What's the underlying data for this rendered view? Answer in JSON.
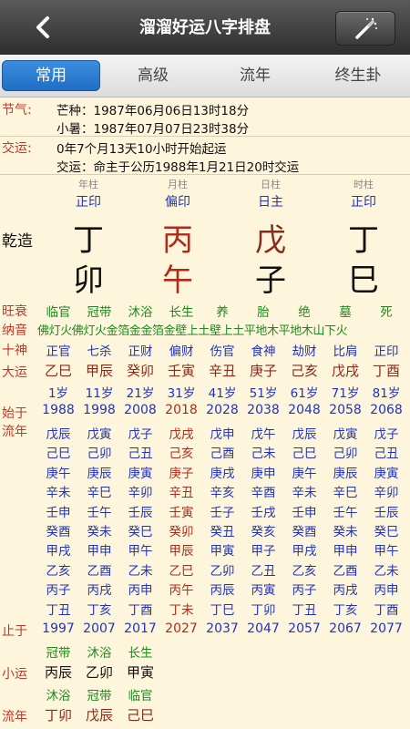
{
  "header": {
    "title": "溜溜好运八字排盘",
    "back_icon": "chevron-left-icon",
    "action_icon": "magic-wand-icon"
  },
  "tabs": [
    {
      "label": "常用",
      "active": true
    },
    {
      "label": "高级",
      "active": false
    },
    {
      "label": "流年",
      "active": false
    },
    {
      "label": "终生卦",
      "active": false
    }
  ],
  "info": {
    "jieqi_label": "节气:",
    "jieqi_1": "芒种：1987年06月06日13时18分",
    "jieqi_2": "小暑：1987年07月07日23时38分",
    "jiaoyun_label": "交运:",
    "jiaoyun_1": "0年7个月13天10小时开始起运",
    "jiaoyun_2": "交运：命主于公历1988年1月21日20时交运"
  },
  "pillars": {
    "headers": [
      "年柱",
      "月柱",
      "日柱",
      "时柱"
    ],
    "shishen": [
      "正印",
      "偏印",
      "日主",
      "正印"
    ],
    "qianzao_label": "乾造",
    "stems": [
      "丁",
      "丙",
      "戊",
      "丁"
    ],
    "branches": [
      "卯",
      "午",
      "子",
      "巳"
    ]
  },
  "wangshuai": {
    "label": "旺衰",
    "values": [
      "临官",
      "冠带",
      "沐浴",
      "长生",
      "养",
      "胎",
      "绝",
      "墓",
      "死"
    ]
  },
  "nayin": {
    "label": "纳音",
    "text": "佛灯火佛灯火金箔金金箔金壁上土壁上土平地木平地木山下火"
  },
  "shishen_row": {
    "label": "十神",
    "values": [
      "正官",
      "七杀",
      "正财",
      "偏财",
      "伤官",
      "食神",
      "劫财",
      "比肩",
      "正印"
    ]
  },
  "dayun": {
    "label": "大运",
    "values": [
      "乙巳",
      "甲辰",
      "癸卯",
      "壬寅",
      "辛丑",
      "庚子",
      "己亥",
      "戊戌",
      "丁酉"
    ],
    "ages": [
      "1岁",
      "11岁",
      "21岁",
      "31岁",
      "41岁",
      "51岁",
      "61岁",
      "71岁",
      "81岁"
    ]
  },
  "start_years": {
    "label": "始于",
    "values": [
      "1988",
      "1998",
      "2008",
      "2018",
      "2028",
      "2038",
      "2048",
      "2058",
      "2068"
    ]
  },
  "liunian_label": "流年",
  "liunian_grid": [
    [
      "戊辰",
      "戊寅",
      "戊子",
      "戊戌",
      "戊申",
      "戊午",
      "戊辰",
      "戊寅",
      "戊子"
    ],
    [
      "己巳",
      "己卯",
      "己丑",
      "己亥",
      "己酉",
      "己未",
      "己巳",
      "己卯",
      "己丑"
    ],
    [
      "庚午",
      "庚辰",
      "庚寅",
      "庚子",
      "庚戌",
      "庚申",
      "庚午",
      "庚辰",
      "庚寅"
    ],
    [
      "辛未",
      "辛巳",
      "辛卯",
      "辛丑",
      "辛亥",
      "辛酉",
      "辛未",
      "辛巳",
      "辛卯"
    ],
    [
      "壬申",
      "壬午",
      "壬辰",
      "壬寅",
      "壬子",
      "壬戌",
      "壬申",
      "壬午",
      "壬辰"
    ],
    [
      "癸酉",
      "癸未",
      "癸巳",
      "癸卯",
      "癸丑",
      "癸亥",
      "癸酉",
      "癸未",
      "癸巳"
    ],
    [
      "甲戌",
      "甲申",
      "甲午",
      "甲辰",
      "甲寅",
      "甲子",
      "甲戌",
      "甲申",
      "甲午"
    ],
    [
      "乙亥",
      "乙酉",
      "乙未",
      "乙巳",
      "乙卯",
      "乙丑",
      "乙亥",
      "乙酉",
      "乙未"
    ],
    [
      "丙子",
      "丙戌",
      "丙申",
      "丙午",
      "丙辰",
      "丙寅",
      "丙子",
      "丙戌",
      "丙申"
    ],
    [
      "丁丑",
      "丁亥",
      "丁酉",
      "丁未",
      "丁巳",
      "丁卯",
      "丁丑",
      "丁亥",
      "丁酉"
    ]
  ],
  "end_years": {
    "label": "止于",
    "values": [
      "1997",
      "2007",
      "2017",
      "2027",
      "2037",
      "2047",
      "2057",
      "2067",
      "2077"
    ]
  },
  "xiaoyun": {
    "label": "小运",
    "top": [
      "冠带",
      "沐浴",
      "长生"
    ],
    "values": [
      "丙辰",
      "乙卯",
      "甲寅"
    ],
    "bottom": [
      "沐浴",
      "冠带",
      "临官"
    ]
  },
  "liunian_bottom": {
    "label": "流年",
    "values": [
      "丁卯",
      "戊辰",
      "己巳"
    ]
  },
  "colors": {
    "accent": "#1f6cc4",
    "label_red": "#c0392b",
    "blue": "#2233bb",
    "green": "#1e8a1e"
  }
}
